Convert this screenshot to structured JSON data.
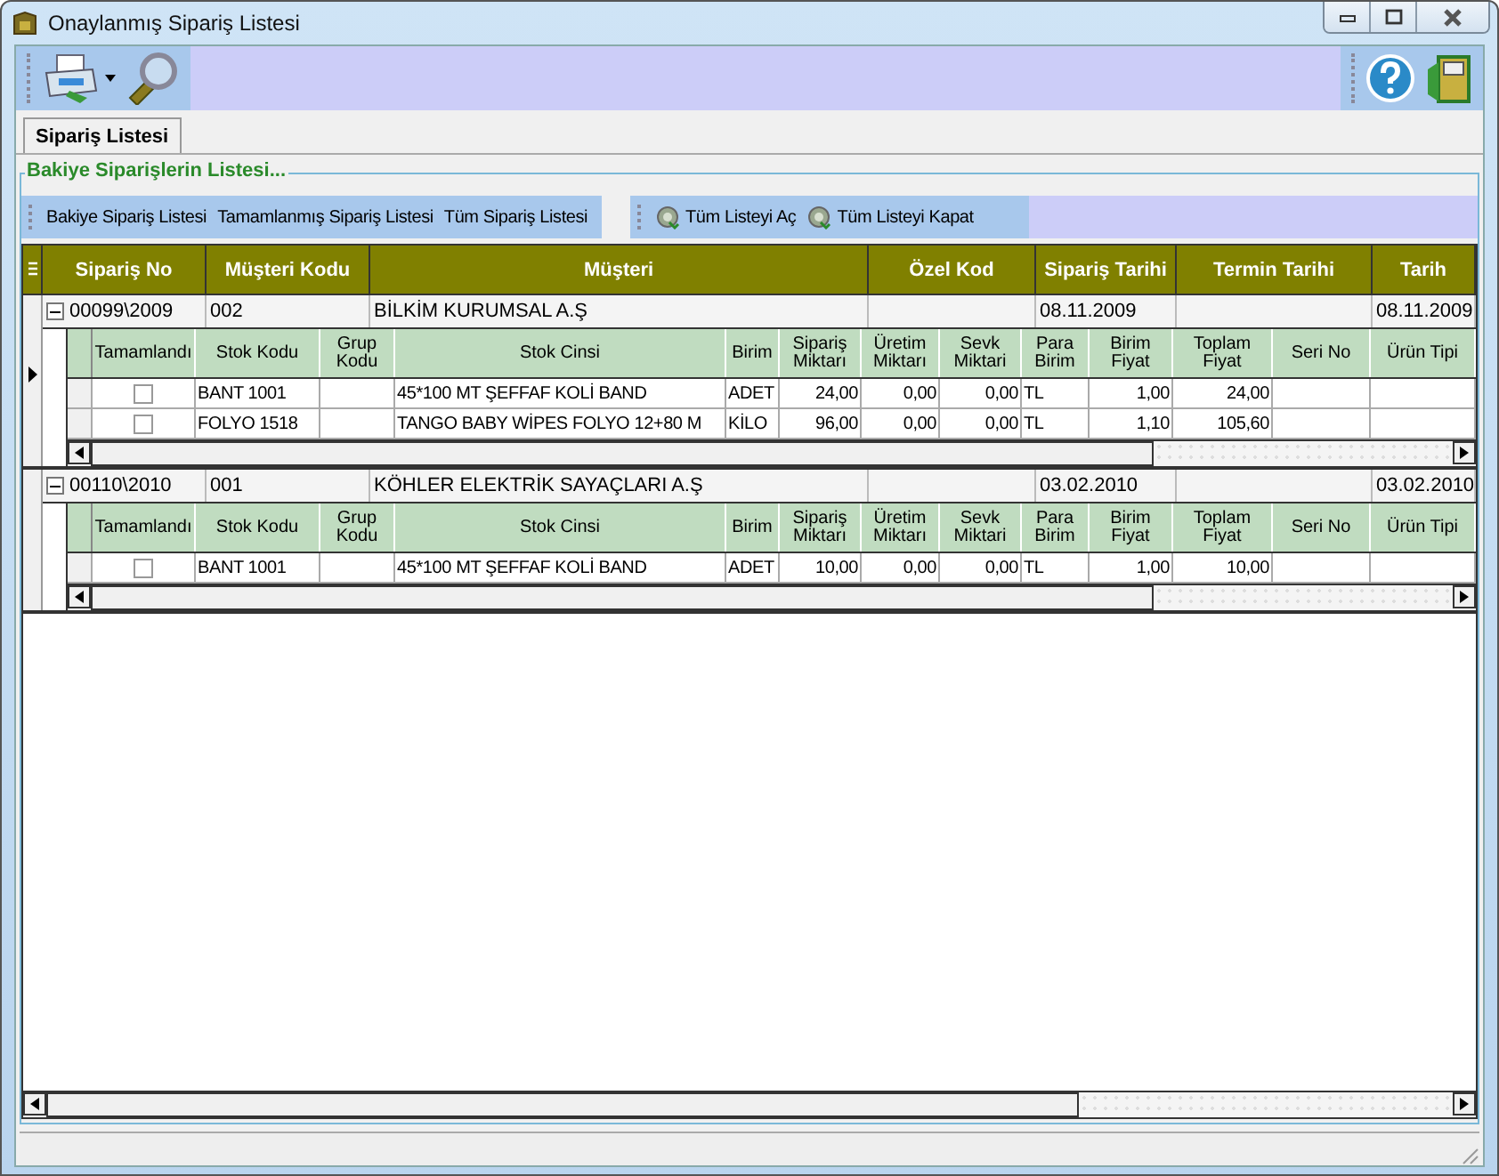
{
  "window": {
    "title": "Onaylanmış Sipariş Listesi"
  },
  "tabs": [
    {
      "label": "Sipariş Listesi",
      "selected": true
    }
  ],
  "group": {
    "title": "Bakiye Siparişlerin Listesi..."
  },
  "list_toolbar": {
    "buttons": [
      {
        "label": "Bakiye Sipariş Listesi",
        "kind": "text"
      },
      {
        "label": "Tamamlanmış Sipariş Listesi",
        "kind": "text"
      },
      {
        "label": "Tüm Sipariş Listesi",
        "kind": "text"
      },
      {
        "label": "Tüm Listeyi Aç",
        "kind": "expand"
      },
      {
        "label": "Tüm Listeyi Kapat",
        "kind": "collapse"
      }
    ]
  },
  "master_columns": [
    "Sipariş No",
    "Müşteri Kodu",
    "Müşteri",
    "Özel Kod",
    "Sipariş Tarihi",
    "Termin Tarihi",
    "Tarih"
  ],
  "orders": [
    {
      "selected": true,
      "expanded": true,
      "siparis_no": "00099\\2009",
      "musteri_kodu": "002",
      "musteri": "BİLKİM KURUMSAL A.Ş",
      "siparis_tarihi": "08.11.2009",
      "tarih": "08.11.2009",
      "detail_columns": [
        "Tamamlandı",
        "Stok Kodu",
        "Grup Kodu",
        "Stok Cinsi",
        "Birim",
        "Sipariş Miktarı",
        "Üretim Miktarı",
        "Sevk Miktari",
        "Para Birim",
        "Birim Fiyat",
        "Toplam Fiyat",
        "Seri No",
        "Ürün Tipi"
      ],
      "rows": [
        {
          "completed": false,
          "stok_kodu": "BANT 1001",
          "stok_cinsi": "45*100 MT ŞEFFAF KOLİ BAND",
          "birim": "ADET",
          "siparis_miktari": "24,00",
          "uretim_miktari": "0,00",
          "sevk_miktari": "0,00",
          "para_birim": "TL",
          "birim_fiyat": "1,00",
          "toplam_fiyat": "24,00"
        },
        {
          "completed": false,
          "stok_kodu": "FOLYO 1518",
          "stok_cinsi": "TANGO BABY WİPES FOLYO 12+80 M",
          "birim": "KİLO",
          "siparis_miktari": "96,00",
          "uretim_miktari": "0,00",
          "sevk_miktari": "0,00",
          "para_birim": "TL",
          "birim_fiyat": "1,10",
          "toplam_fiyat": "105,60"
        }
      ]
    },
    {
      "selected": false,
      "expanded": true,
      "siparis_no": "00110\\2010",
      "musteri_kodu": "001",
      "musteri": "KÖHLER ELEKTRİK SAYAÇLARI A.Ş",
      "siparis_tarihi": "03.02.2010",
      "tarih": "03.02.2010",
      "detail_columns": [
        "Tamamlandı",
        "Stok Kodu",
        "Grup Kodu",
        "Stok Cinsi",
        "Birim",
        "Sipariş Miktarı",
        "Üretim Miktarı",
        "Sevk Miktari",
        "Para Birim",
        "Birim Fiyat",
        "Toplam Fiyat",
        "Seri No",
        "Ürün Tipi"
      ],
      "rows": [
        {
          "completed": false,
          "stok_kodu": "BANT 1001",
          "stok_cinsi": "45*100 MT ŞEFFAF KOLİ BAND",
          "birim": "ADET",
          "siparis_miktari": "10,00",
          "uretim_miktari": "0,00",
          "sevk_miktari": "0,00",
          "para_birim": "TL",
          "birim_fiyat": "1,00",
          "toplam_fiyat": "10,00"
        }
      ]
    }
  ]
}
